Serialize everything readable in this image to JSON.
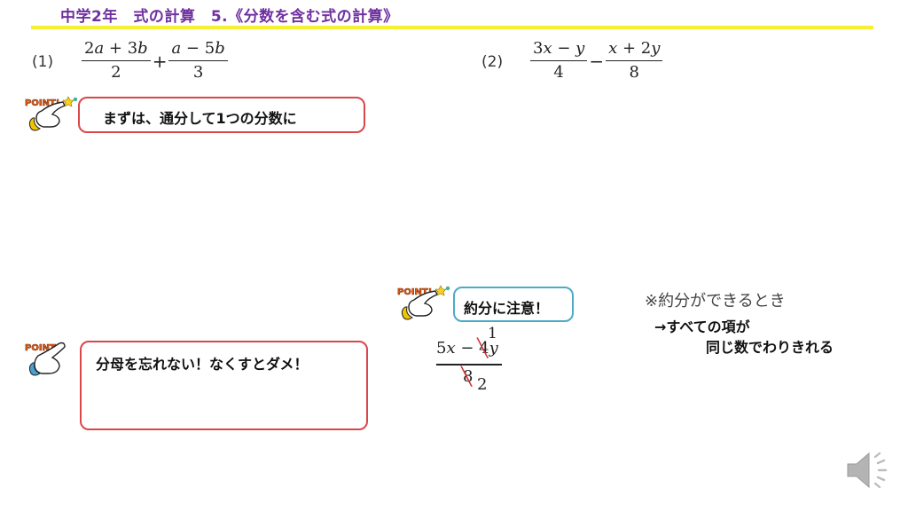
{
  "header": {
    "title": "中学2年　式の計算　5.《分数を含む式の計算》"
  },
  "problems": [
    {
      "number": "(1)",
      "terms": [
        {
          "numerator": [
            "2",
            "a",
            " + 3",
            "b"
          ],
          "denominator": "2"
        },
        {
          "operator": "+"
        },
        {
          "numerator": [
            "",
            "a",
            " − 5",
            "b"
          ],
          "denominator": "3"
        }
      ],
      "n1_pre": "2",
      "n1_v1": "a",
      "n1_mid": " + 3",
      "n1_v2": "b",
      "d1": "2",
      "op": "+",
      "n2_v1": "a",
      "n2_mid": " − 5",
      "n2_v2": "b",
      "d2": "3"
    },
    {
      "number": "(2)",
      "n1_pre": "3",
      "n1_v1": "x",
      "n1_mid": " − ",
      "n1_v2": "y",
      "d1": "4",
      "op": "−",
      "n2_v1": "x",
      "n2_mid": " + 2",
      "n2_v2": "y",
      "d2": "8"
    }
  ],
  "points": [
    {
      "icon": "point-pointing-hand-icon",
      "label": "POINT!",
      "text": "まずは、通分して1つの分数に"
    },
    {
      "icon": "point-pointing-hand-icon",
      "label": "POINT!",
      "text": "約分に注意！"
    },
    {
      "icon": "point-pointing-hand-icon",
      "label": "POINT!",
      "text": "分母を忘れない！なくすとダメ！"
    }
  ],
  "reduction_example": {
    "num_pre": "5",
    "num_v1": "x",
    "num_mid": " − ",
    "crossed_num": "4",
    "reduced_num": "1",
    "num_v2": "y",
    "crossed_den": "8",
    "reduced_den": "2"
  },
  "notes": {
    "line1": "※約分ができるとき",
    "line2": "→すべての項が",
    "line3": "同じ数でわりきれる"
  },
  "audio": {
    "icon": "speaker-icon"
  },
  "colors": {
    "title": "#7030a0",
    "rule": "#f5f032",
    "box_red": "#d9474a",
    "box_blue": "#4bacc6",
    "strike": "#d23030"
  }
}
